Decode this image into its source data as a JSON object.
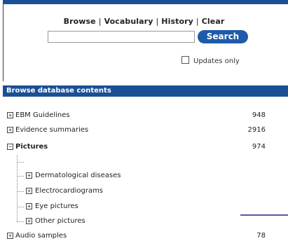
{
  "nav": {
    "browse": "Browse",
    "vocabulary": "Vocabulary",
    "history": "History",
    "clear": "Clear",
    "separator": "|"
  },
  "search": {
    "value": "",
    "button_label": "Search"
  },
  "updates_only": {
    "label": "Updates only",
    "checked": false
  },
  "browse_section": {
    "title": "Browse database contents",
    "items": [
      {
        "label": "EBM Guidelines",
        "count": "948",
        "expander": "+"
      },
      {
        "label": "Evidence summaries",
        "count": "2916",
        "expander": "+"
      },
      {
        "label": "Pictures",
        "count": "974",
        "expander": "−"
      },
      {
        "label": "Audio samples",
        "count": "78",
        "expander": "+"
      }
    ],
    "sub_items": [
      {
        "label": "Dermatological diseases",
        "expander": "+"
      },
      {
        "label": "Electrocardiograms",
        "expander": "+"
      },
      {
        "label": "Eye pictures",
        "expander": "+"
      },
      {
        "label": "Other pictures",
        "expander": "+"
      }
    ]
  },
  "colors": {
    "header_blue": "#1b4f96",
    "button_blue": "#1e5ba8",
    "accent_purple": "#5a55a8"
  }
}
